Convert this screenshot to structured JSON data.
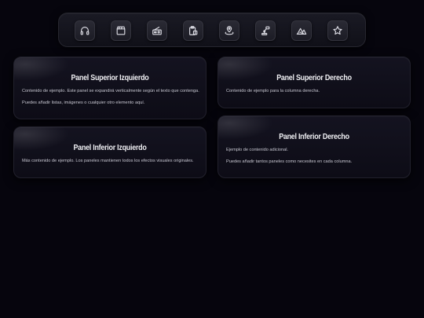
{
  "toolbar": {
    "buttons": [
      {
        "icon": "headphones-icon"
      },
      {
        "icon": "clapperboard-icon"
      },
      {
        "icon": "radio-icon"
      },
      {
        "icon": "clipboard-icon"
      },
      {
        "icon": "location-pin-icon"
      },
      {
        "icon": "robot-arm-icon"
      },
      {
        "icon": "camping-icon"
      },
      {
        "icon": "star-icon"
      }
    ]
  },
  "panels": {
    "top_left": {
      "title": "Panel Superior Izquierdo",
      "lines": [
        "Contenido de ejemplo. Este panel se expandirá verticalmente según el texto que contenga.",
        "Puedes añadir listas, imágenes o cualquier otro elemento aquí."
      ]
    },
    "bottom_left": {
      "title": "Panel Inferior Izquierdo",
      "lines": [
        "Más contenido de ejemplo. Los paneles mantienen todos los efectos visuales originales."
      ]
    },
    "top_right": {
      "title": "Panel Superior Derecho",
      "lines": [
        "Contenido de ejemplo para la columna derecha."
      ]
    },
    "bottom_right": {
      "title": "Panel Inferior Derecho",
      "lines": [
        "Ejemplo de contenido adicional.",
        "Puedes añadir tantos paneles como necesites en cada columna."
      ]
    }
  }
}
